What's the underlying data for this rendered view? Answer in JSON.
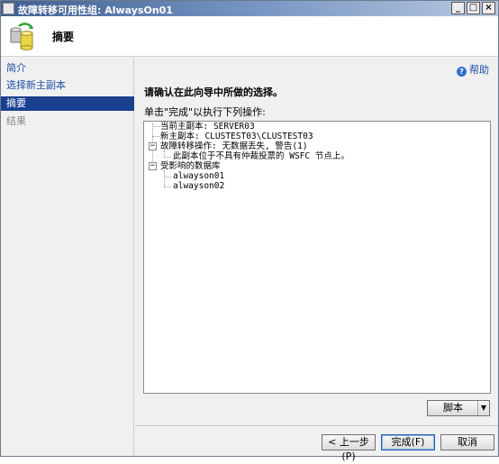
{
  "window": {
    "title": "故障转移可用性组: AlwaysOn01",
    "minimize": "_",
    "maximize": "□",
    "close": "×"
  },
  "header": {
    "title": "摘要"
  },
  "sidebar": {
    "items": [
      {
        "label": "简介",
        "state": "link"
      },
      {
        "label": "选择新主副本",
        "state": "link"
      },
      {
        "label": "摘要",
        "state": "selected"
      },
      {
        "label": "结果",
        "state": "disabled"
      }
    ]
  },
  "main": {
    "help": "帮助",
    "confirm": "请确认在此向导中所做的选择。",
    "instruction": "单击\"完成\"以执行下列操作:",
    "tree": {
      "current_primary": "当前主副本: SERVER03",
      "new_primary": "新主副本: CLUSTEST03\\CLUSTEST03",
      "failover_op": "故障转移操作: 无数据丢失, 警告(1)",
      "failover_warning": "此副本位于不具有仲裁投票的 WSFC 节点上。",
      "affected_dbs": "受影响的数据库",
      "databases": [
        "alwayson01",
        "alwayson02"
      ]
    }
  },
  "buttons": {
    "script": "脚本",
    "script_arrow": "▼",
    "back": "< 上一步(P)",
    "finish": "完成(F)",
    "cancel": "取消"
  }
}
